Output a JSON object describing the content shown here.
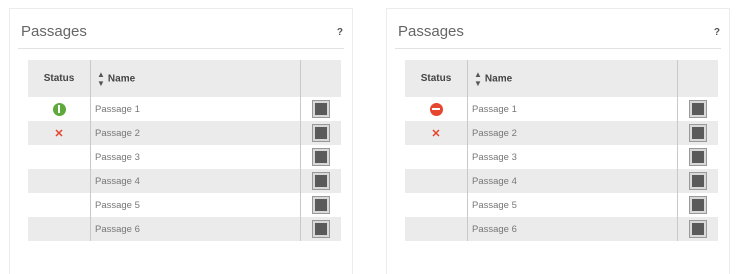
{
  "panels": [
    {
      "title": "Passages",
      "help": "?",
      "headers": {
        "status": "Status",
        "name": "Name",
        "sort_icon": "sort-arrows-icon"
      },
      "rows": [
        {
          "name": "Passage 1",
          "status": "ok",
          "status_icon": "green-ok-icon"
        },
        {
          "name": "Passage 2",
          "status": "error",
          "status_icon": "red-x-icon"
        },
        {
          "name": "Passage 3",
          "status": ""
        },
        {
          "name": "Passage 4",
          "status": ""
        },
        {
          "name": "Passage 5",
          "status": ""
        },
        {
          "name": "Passage 6",
          "status": ""
        }
      ]
    },
    {
      "title": "Passages",
      "help": "?",
      "headers": {
        "status": "Status",
        "name": "Name",
        "sort_icon": "sort-arrows-icon"
      },
      "rows": [
        {
          "name": "Passage 1",
          "status": "blocked",
          "status_icon": "red-no-entry-icon"
        },
        {
          "name": "Passage 2",
          "status": "error",
          "status_icon": "red-x-icon"
        },
        {
          "name": "Passage 3",
          "status": ""
        },
        {
          "name": "Passage 4",
          "status": ""
        },
        {
          "name": "Passage 5",
          "status": ""
        },
        {
          "name": "Passage 6",
          "status": ""
        }
      ]
    }
  ],
  "colors": {
    "ok": "#5fa83c",
    "error": "#e6452e",
    "row_stripe": "#ebebeb"
  }
}
